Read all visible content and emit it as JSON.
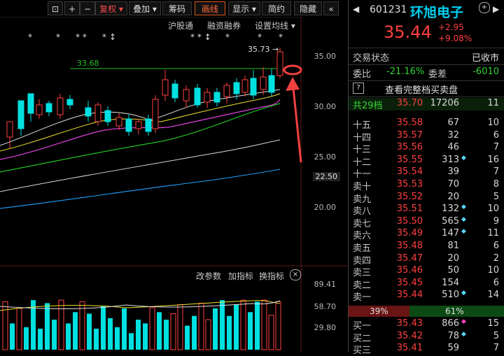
{
  "toolbar": {
    "buttons": [
      {
        "label": "⊡",
        "name": "screenshot-icon"
      },
      {
        "label": "+",
        "name": "zoom-in-icon"
      },
      {
        "label": "−",
        "name": "zoom-out-icon"
      },
      {
        "label": "复权 ▾",
        "name": "adjust-button"
      },
      {
        "label": "叠加 ▾",
        "name": "overlay-button"
      },
      {
        "label": "筹码",
        "name": "chips-button"
      },
      {
        "label": "画线",
        "name": "draw-line-button"
      },
      {
        "label": "显示 ▾",
        "name": "display-button"
      },
      {
        "label": "简约",
        "name": "simple-button"
      },
      {
        "label": "隐藏",
        "name": "hide-button"
      },
      {
        "label": "«",
        "name": "collapse-icon"
      }
    ]
  },
  "chart": {
    "top_links": [
      "沪股通",
      "融资融券",
      "设置均线 ▾"
    ],
    "high_label": "35.73",
    "level_label": "33.68",
    "price_axis": [
      "35.00",
      "30.00",
      "25.00",
      "22.50",
      "20.00"
    ],
    "sub_links": [
      "改参数",
      "加指标",
      "换指标"
    ],
    "vol_axis": [
      "89.41",
      "58.70",
      "29.80"
    ],
    "volume_bars": [
      {
        "v": 64,
        "c": "r"
      },
      {
        "v": 35,
        "c": "c"
      },
      {
        "v": 55,
        "c": "r"
      },
      {
        "v": 30,
        "c": "c"
      },
      {
        "v": 66,
        "c": "c"
      },
      {
        "v": 28,
        "c": "c"
      },
      {
        "v": 62,
        "c": "c"
      },
      {
        "v": 40,
        "c": "c"
      },
      {
        "v": 66,
        "c": "r"
      },
      {
        "v": 35,
        "c": "c"
      },
      {
        "v": 50,
        "c": "c"
      },
      {
        "v": 64,
        "c": "r"
      },
      {
        "v": 48,
        "c": "c"
      },
      {
        "v": 28,
        "c": "c"
      },
      {
        "v": 58,
        "c": "c"
      },
      {
        "v": 42,
        "c": "c"
      },
      {
        "v": 30,
        "c": "c"
      },
      {
        "v": 55,
        "c": "c"
      },
      {
        "v": 22,
        "c": "c"
      },
      {
        "v": 40,
        "c": "c"
      },
      {
        "v": 35,
        "c": "c"
      },
      {
        "v": 56,
        "c": "r"
      },
      {
        "v": 50,
        "c": "c"
      },
      {
        "v": 40,
        "c": "c"
      },
      {
        "v": 48,
        "c": "r"
      },
      {
        "v": 60,
        "c": "r"
      },
      {
        "v": 32,
        "c": "c"
      },
      {
        "v": 45,
        "c": "c"
      },
      {
        "v": 62,
        "c": "r"
      },
      {
        "v": 40,
        "c": "r"
      },
      {
        "v": 55,
        "c": "c"
      },
      {
        "v": 66,
        "c": "c"
      },
      {
        "v": 45,
        "c": "c"
      },
      {
        "v": 60,
        "c": "c"
      },
      {
        "v": 66,
        "c": "r"
      },
      {
        "v": 50,
        "c": "c"
      },
      {
        "v": 64,
        "c": "c"
      },
      {
        "v": 66,
        "c": "r"
      },
      {
        "v": 46,
        "c": "r"
      },
      {
        "v": 64,
        "c": "r"
      }
    ]
  },
  "quote": {
    "code": "601231",
    "name": "环旭电子",
    "price": "35.44",
    "change": "+2.95",
    "change_pct": "+9.08%",
    "status_label": "交易状态",
    "status_value": "已收市",
    "ratio_label": "委比",
    "ratio_value": "-21.16%",
    "diff_label": "委差",
    "diff_value": "-6010",
    "full_book_link": "查看完整档买卖盘",
    "total_label": "共29档",
    "total_price": "35.70",
    "total_vol": "17206",
    "total_cnt": "11",
    "asks": [
      {
        "label": "十五",
        "price": "35.58",
        "vol": "67",
        "dot": "",
        "cnt": "10"
      },
      {
        "label": "十四",
        "price": "35.57",
        "vol": "32",
        "dot": "",
        "cnt": "6"
      },
      {
        "label": "十三",
        "price": "35.56",
        "vol": "46",
        "dot": "",
        "cnt": "7"
      },
      {
        "label": "十二",
        "price": "35.55",
        "vol": "313",
        "dot": "◆",
        "cnt": "16"
      },
      {
        "label": "十一",
        "price": "35.54",
        "vol": "39",
        "dot": "",
        "cnt": "7"
      },
      {
        "label": "卖十",
        "price": "35.53",
        "vol": "70",
        "dot": "",
        "cnt": "8"
      },
      {
        "label": "卖九",
        "price": "35.52",
        "vol": "20",
        "dot": "",
        "cnt": "5"
      },
      {
        "label": "卖八",
        "price": "35.51",
        "vol": "132",
        "dot": "◆",
        "cnt": "10"
      },
      {
        "label": "卖七",
        "price": "35.50",
        "vol": "565",
        "dot": "◆",
        "cnt": "9"
      },
      {
        "label": "卖六",
        "price": "35.49",
        "vol": "147",
        "dot": "◆",
        "cnt": "11"
      },
      {
        "label": "卖五",
        "price": "35.48",
        "vol": "81",
        "dot": "",
        "cnt": "6"
      },
      {
        "label": "卖四",
        "price": "35.47",
        "vol": "20",
        "dot": "",
        "cnt": "2"
      },
      {
        "label": "卖三",
        "price": "35.46",
        "vol": "50",
        "dot": "",
        "cnt": "10"
      },
      {
        "label": "卖二",
        "price": "35.45",
        "vol": "154",
        "dot": "",
        "cnt": "6"
      },
      {
        "label": "卖一",
        "price": "35.44",
        "vol": "510",
        "dot": "◆",
        "cnt": "14"
      }
    ],
    "split_sell": "39%",
    "split_buy": "61%",
    "bids": [
      {
        "label": "买一",
        "price": "35.43",
        "vol": "866",
        "dot": "◆",
        "cnt": "15"
      },
      {
        "label": "买二",
        "price": "35.42",
        "vol": "78",
        "dot": "◆",
        "cnt": "5"
      },
      {
        "label": "买三",
        "price": "35.41",
        "vol": "59",
        "dot": "",
        "cnt": "7"
      }
    ]
  },
  "colors": {
    "up": "#ff4040",
    "down": "#34d234",
    "cyan": "#00e0e0",
    "accent": "#e05a1c"
  }
}
